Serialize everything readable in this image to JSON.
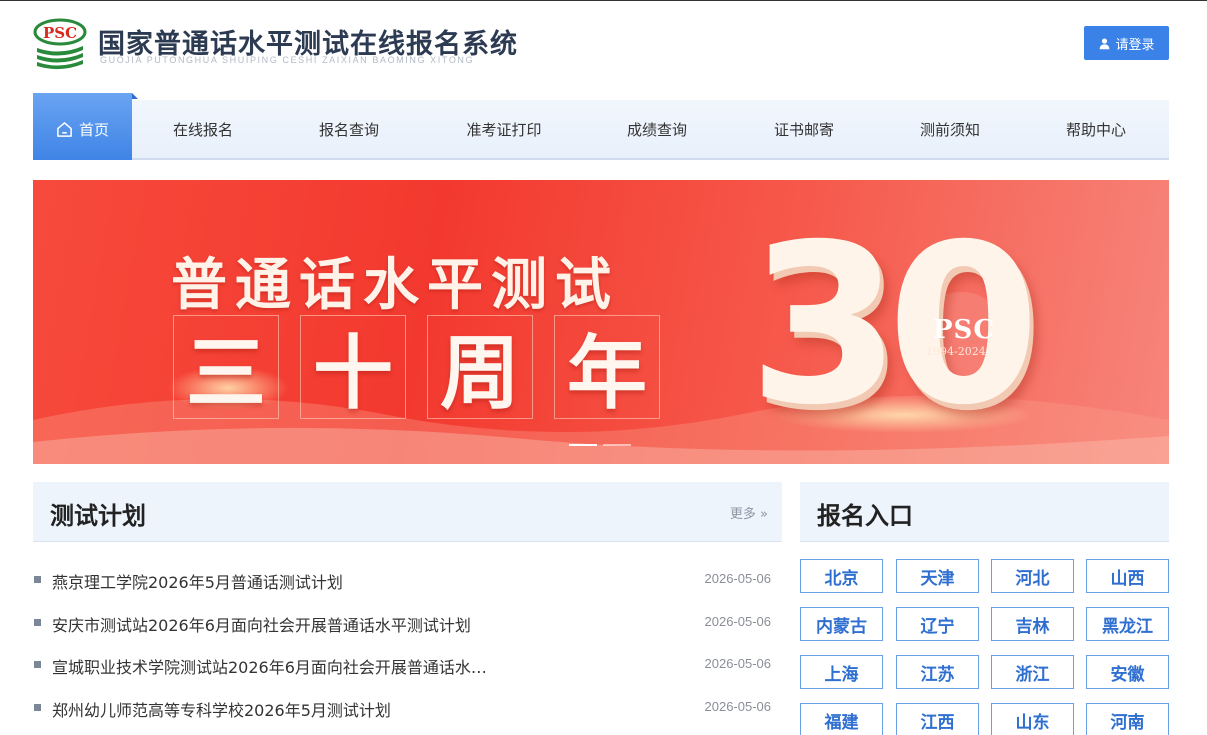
{
  "header": {
    "logo_text": "PSC",
    "title": "国家普通话水平测试在线报名系统",
    "pinyin": "GUOJIA PUTONGHUA SHUIPING CESHI ZAIXIAN BAOMING XITONG",
    "login_label": "请登录"
  },
  "nav": {
    "home": "首页",
    "items": [
      "在线报名",
      "报名查询",
      "准考证打印",
      "成绩查询",
      "证书邮寄",
      "测前须知",
      "帮助中心"
    ]
  },
  "banner": {
    "line1": "普通话水平测试",
    "line2": [
      "三",
      "十",
      "周",
      "年"
    ],
    "number": "30",
    "badge": "PSC",
    "years": "1994-2024",
    "slide_count": 2,
    "active_slide": 1
  },
  "plans": {
    "title": "测试计划",
    "more": "更多",
    "items": [
      {
        "title": "燕京理工学院2026年5月普通话测试计划",
        "date": "2026-05-06"
      },
      {
        "title": "安庆市测试站2026年6月面向社会开展普通话水平测试计划",
        "date": "2026-05-06"
      },
      {
        "title": "宣城职业技术学院测试站2026年6月面向社会开展普通话水…",
        "date": "2026-05-06"
      },
      {
        "title": "郑州幼儿师范高等专科学校2026年5月测试计划",
        "date": "2026-05-06"
      }
    ]
  },
  "signup": {
    "title": "报名入口",
    "provinces": [
      "北京",
      "天津",
      "河北",
      "山西",
      "内蒙古",
      "辽宁",
      "吉林",
      "黑龙江",
      "上海",
      "江苏",
      "浙江",
      "安徽",
      "福建",
      "江西",
      "山东",
      "河南"
    ]
  },
  "colors": {
    "primary": "#3b82e8",
    "banner_red": "#f3392f",
    "panel_bg": "#edf4fc"
  }
}
